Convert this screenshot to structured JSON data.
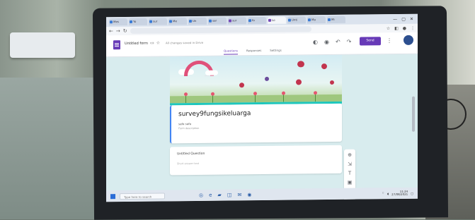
{
  "browser": {
    "tabs": [
      {
        "label": "Mes"
      },
      {
        "label": "Yo"
      },
      {
        "label": "sur"
      },
      {
        "label": "Me"
      },
      {
        "label": "Un"
      },
      {
        "label": "ser"
      },
      {
        "label": "sur"
      },
      {
        "label": "fo"
      },
      {
        "label": "Lo"
      },
      {
        "label": "Unti"
      },
      {
        "label": "Ma"
      },
      {
        "label": "Mi"
      }
    ],
    "window_controls": [
      "—",
      "▢",
      "✕"
    ]
  },
  "forms_app": {
    "doc_title": "Untitled form",
    "save_status": "All changes saved in Drive",
    "send_label": "Send",
    "tabs": [
      {
        "label": "Questions",
        "active": true
      },
      {
        "label": "Responses",
        "active": false
      },
      {
        "label": "Settings",
        "active": false
      }
    ],
    "accent_color": "#673ab7",
    "theme_color": "#1ec7bd"
  },
  "form": {
    "title": "survey9fungsikeluarga",
    "subtitle": "safa safa",
    "description": "Form description",
    "question_label": "Untitled Question",
    "answer_placeholder": "Short answer text"
  },
  "taskbar": {
    "search_placeholder": "Type here to search",
    "time": "11:24",
    "date": "27/08/2021"
  }
}
